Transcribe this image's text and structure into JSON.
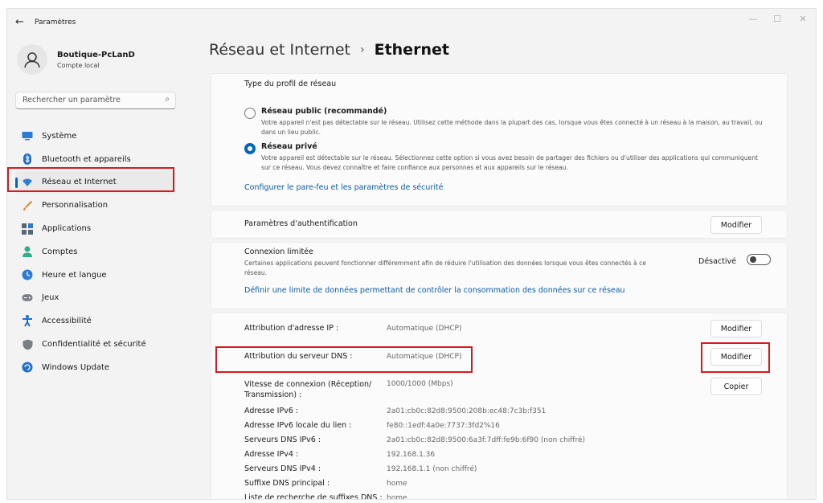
{
  "app": {
    "title": "Paramètres",
    "back_glyph": "←",
    "controls": {
      "minimize": "—",
      "maximize": "☐",
      "close": "✕"
    }
  },
  "profile": {
    "name": "Boutique-PcLanD",
    "subtitle": "Compte local"
  },
  "search": {
    "placeholder": "Rechercher un paramètre",
    "icon": "search-icon"
  },
  "sidebar": {
    "items": [
      {
        "label": "Système",
        "icon": "monitor-icon",
        "color": "#2b7ad6"
      },
      {
        "label": "Bluetooth et appareils",
        "icon": "bluetooth-icon",
        "color": "#1f6fd1"
      },
      {
        "label": "Réseau et Internet",
        "icon": "wifi-icon",
        "color": "#2d7fd8",
        "active": true
      },
      {
        "label": "Personnalisation",
        "icon": "brush-icon",
        "color": "#e28a36"
      },
      {
        "label": "Applications",
        "icon": "apps-icon",
        "color": "#5a6676"
      },
      {
        "label": "Comptes",
        "icon": "person-icon",
        "color": "#2fb08a"
      },
      {
        "label": "Heure et langue",
        "icon": "clock-globe-icon",
        "color": "#2b7ad6"
      },
      {
        "label": "Jeux",
        "icon": "gamepad-icon",
        "color": "#7a7f86"
      },
      {
        "label": "Accessibilité",
        "icon": "accessibility-icon",
        "color": "#1f6fd1"
      },
      {
        "label": "Confidentialité et sécurité",
        "icon": "shield-icon",
        "color": "#7a7f86"
      },
      {
        "label": "Windows Update",
        "icon": "update-icon",
        "color": "#1f6fd1"
      }
    ]
  },
  "breadcrumb": {
    "parent": "Réseau et Internet",
    "separator": "›",
    "current": "Ethernet"
  },
  "profile_type": {
    "title": "Type du profil de réseau",
    "public": {
      "label": "Réseau public (recommandé)",
      "desc": "Votre appareil n'est pas détectable sur le réseau. Utilisez cette méthode dans la plupart des cas, lorsque vous êtes connecté à un réseau à la maison, au travail, ou dans un lieu public.",
      "checked": false
    },
    "private": {
      "label": "Réseau privé",
      "desc": "Votre appareil est détectable sur le réseau. Sélectionnez cette option si vous avez besoin de partager des fichiers ou d'utiliser des applications qui communiquent sur ce réseau. Vous devez connaître et faire confiance aux personnes et aux appareils sur le réseau.",
      "checked": true
    },
    "firewall_link": "Configurer le pare-feu et les paramètres de sécurité"
  },
  "auth": {
    "label": "Paramètres d'authentification",
    "button": "Modifier"
  },
  "metered": {
    "label": "Connexion limitée",
    "desc": "Certaines applications peuvent fonctionner différemment afin de réduire l'utilisation des données lorsque vous êtes connectés à ce réseau.",
    "toggle_state": "Désactivé",
    "enabled": false,
    "data_limit_link": "Définir une limite de données permettant de contrôler la consommation des données sur ce réseau"
  },
  "ip": {
    "ip_assignment": {
      "label": "Attribution d'adresse IP :",
      "value": "Automatique (DHCP)",
      "button": "Modifier"
    },
    "dns_assignment": {
      "label": "Attribution du serveur DNS :",
      "value": "Automatique (DHCP)",
      "button": "Modifier"
    },
    "link_speed": {
      "label": "Vitesse de connexion (Réception/ Transmission) :",
      "value": "1000/1000 (Mbps)",
      "button": "Copier"
    },
    "details": [
      {
        "label": "Adresse IPv6 :",
        "value": "2a01:cb0c:82d8:9500:208b:ec48:7c3b:f351"
      },
      {
        "label": "Adresse IPv6 locale du lien :",
        "value": "fe80::1edf:4a0e:7737:3fd2%16"
      },
      {
        "label": "Serveurs DNS IPv6 :",
        "value": "2a01:cb0c:82d8:9500:6a3f:7dff:fe9b:6f90 (non chiffré)"
      },
      {
        "label": "Adresse IPv4 :",
        "value": "192.168.1.36"
      },
      {
        "label": "Serveurs DNS IPv4 :",
        "value": "192.168.1.1 (non chiffré)"
      },
      {
        "label": "Suffixe DNS principal :",
        "value": "home"
      },
      {
        "label": "Liste de recherche de suffixes DNS :",
        "value": "home"
      }
    ]
  },
  "colors": {
    "accent": "#0067c0",
    "link": "#0a5ca8",
    "highlight_border": "#d9181e"
  }
}
